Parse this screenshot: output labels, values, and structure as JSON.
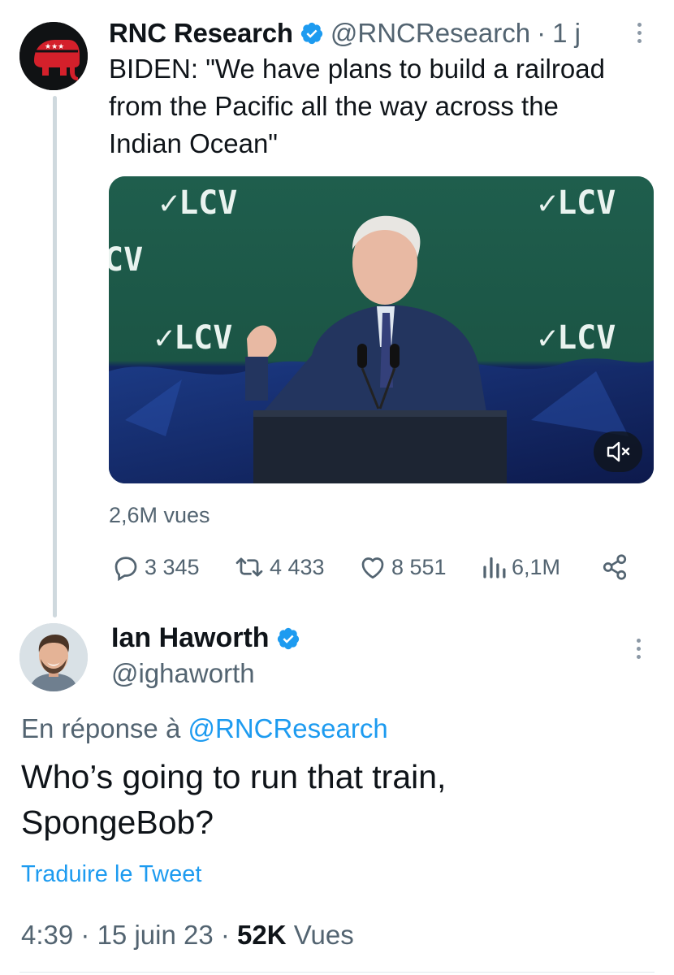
{
  "parent_tweet": {
    "author_name": "RNC Research",
    "handle": "@RNCResearch",
    "separator": "·",
    "time_ago": "1 j",
    "text": "BIDEN: \"We have plans to build a railroad\nfrom the Pacific all the way across the\nIndian Ocean\"",
    "media": {
      "banner_text": "✓LCV",
      "cut_banner_text": "CV"
    },
    "views": "2,6M vues",
    "actions": {
      "replies": "3 345",
      "retweets": "4 433",
      "likes": "8 551",
      "analytics": "6,1M"
    }
  },
  "reply_tweet": {
    "author_name": "Ian Haworth",
    "handle": "@ighaworth",
    "in_reply_prefix": "En réponse à",
    "in_reply_mention": "@RNCResearch",
    "text": "Who’s going to run that train,\nSpongeBob?",
    "translate_label": "Traduire le Tweet",
    "time": "4:39",
    "date": "15 juin 23",
    "dot": "·",
    "views_count": "52K",
    "views_label": "Vues"
  },
  "colors": {
    "accent": "#1d9bf0",
    "text": "#0f1419",
    "muted": "#536471"
  },
  "icons": [
    "rnc-elephant-logo",
    "verified-badge-icon",
    "more-icon",
    "mute-icon",
    "reply-icon",
    "retweet-icon",
    "like-icon",
    "analytics-icon",
    "share-icon"
  ]
}
